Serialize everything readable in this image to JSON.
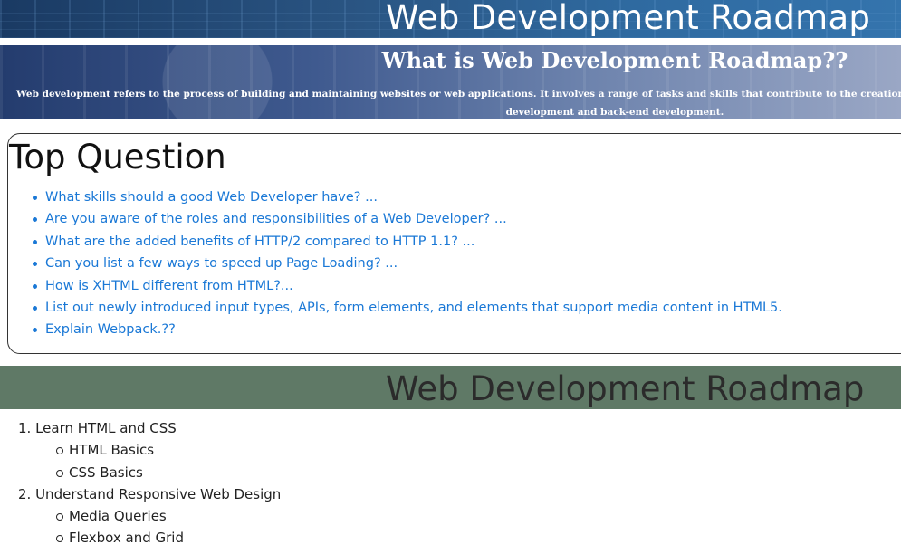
{
  "header": {
    "title": "Web Development Roadmap"
  },
  "intro": {
    "heading": "What is Web Development Roadmap??",
    "text": "Web development refers to the process of building and maintaining websites or web applications. It involves a range of tasks and skills that contribute to the creation of a functional, down into two main categories: front-end development and back-end development."
  },
  "questions": {
    "heading": "Top Question",
    "items": [
      "What skills should a good Web Developer have? ...",
      "Are you aware of the roles and responsibilities of a Web Developer? ...",
      "What are the added benefits of HTTP/2 compared to HTTP 1.1? ...",
      "Can you list a few ways to speed up Page Loading? ...",
      "How is XHTML different from HTML?...",
      "List out newly introduced input types, APIs, form elements, and elements that support media content in HTML5.",
      "Explain Webpack.??"
    ]
  },
  "roadmap": {
    "title": "Web Development Roadmap",
    "steps": [
      {
        "label": "1. Learn HTML and CSS",
        "subs": [
          "HTML Basics",
          "CSS Basics"
        ]
      },
      {
        "label": "2. Understand Responsive Web Design",
        "subs": [
          "Media Queries",
          "Flexbox and Grid"
        ]
      }
    ]
  }
}
